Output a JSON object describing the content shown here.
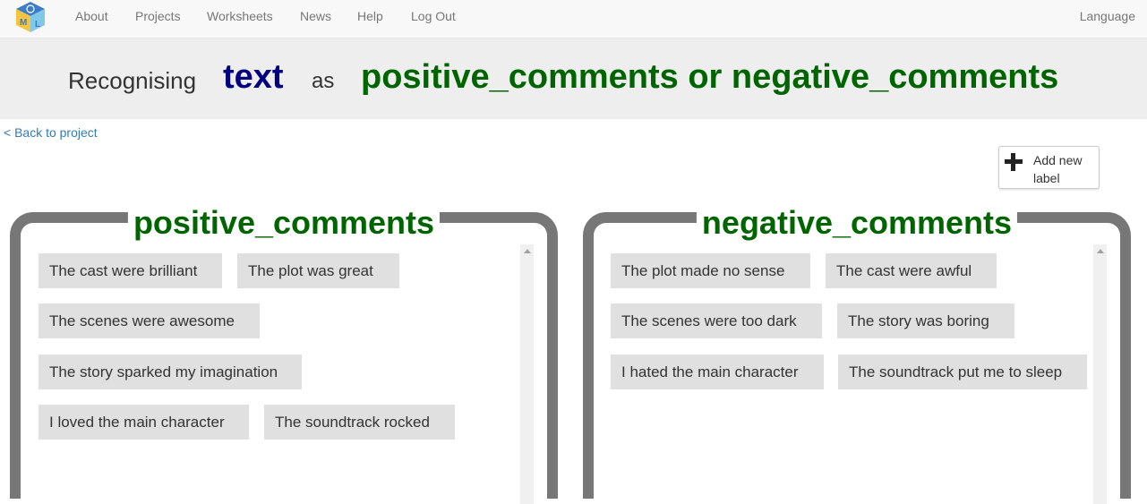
{
  "nav": {
    "items": [
      "About",
      "Projects",
      "Worksheets",
      "News",
      "Help",
      "Log Out"
    ],
    "language": "Language"
  },
  "title": {
    "prefix": "Recognising",
    "subject": "text",
    "connector": "as",
    "labels": "positive_comments or negative_comments"
  },
  "back_link": "< Back to project",
  "add_label": {
    "line1": "Add new",
    "line2": "label"
  },
  "buckets": [
    {
      "name": "positive_comments",
      "examples": [
        "The cast were brilliant",
        "The plot was great",
        "The scenes were awesome",
        "The story sparked my imagination",
        "I loved the main character",
        "The soundtrack rocked"
      ]
    },
    {
      "name": "negative_comments",
      "examples": [
        "The plot made no sense",
        "The cast were awful",
        "The scenes were too dark",
        "The story was boring",
        "I hated the main character",
        "The soundtrack put me to sleep"
      ]
    }
  ],
  "colors": {
    "label_green": "#006400",
    "subject_navy": "#000080",
    "bucket_border": "#777777",
    "example_bg": "#e0e0e0",
    "link_blue": "#337ab7"
  }
}
